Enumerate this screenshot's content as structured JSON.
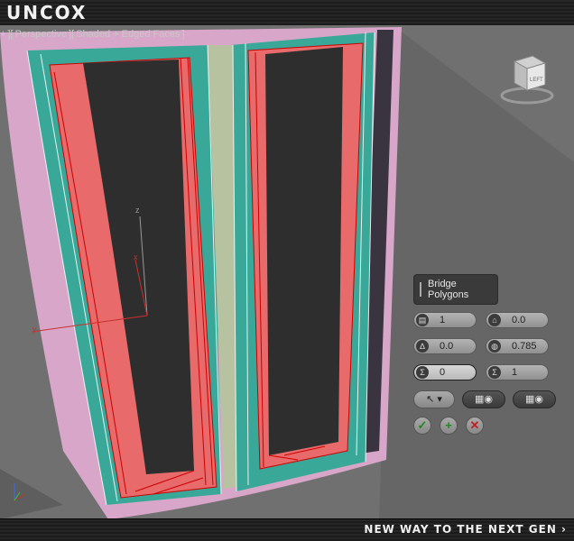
{
  "header": {
    "logo": "UNCOX"
  },
  "footer": {
    "tagline": "NEW WAY TO THE NEXT GEN ›"
  },
  "viewport": {
    "labels": [
      "+",
      "][",
      "Perspective",
      "][",
      "Shaded + Edged Faces",
      "]"
    ],
    "axis_gizmo": {
      "z": "z",
      "x": "x",
      "y": "y"
    },
    "viewcube_face": "LEFT"
  },
  "caddy": {
    "title": "Bridge Polygons",
    "fields": [
      {
        "icon": "segments-icon",
        "value": "1"
      },
      {
        "icon": "taper-icon",
        "value": "0.0"
      },
      {
        "icon": "bias-icon",
        "value": "0.0"
      },
      {
        "icon": "smooth-icon",
        "value": "0.785"
      },
      {
        "icon": "twist-1-icon",
        "value": "0"
      },
      {
        "icon": "twist-2-icon",
        "value": "1"
      }
    ],
    "actions": {
      "ok": "✓",
      "apply": "+",
      "cancel": "✕"
    }
  },
  "colors": {
    "selected_face": "#e86a6a",
    "teal_border": "#3aa899",
    "pink_frame": "#d8a6c8",
    "center_strip": "#b7c2a0",
    "interior": "#2e2e2e"
  }
}
